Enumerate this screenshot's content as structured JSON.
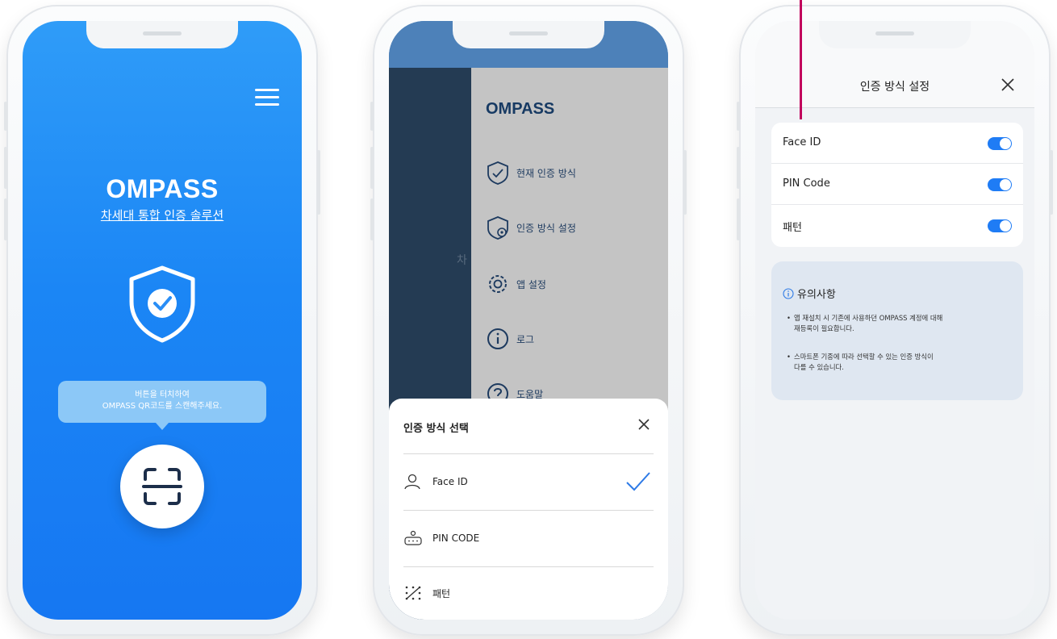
{
  "phone1": {
    "brand": "OMPASS",
    "subtitle": "차세대 통합 인증 솔루션",
    "tooltip_line1": "버튼을 터치하여",
    "tooltip_line2": "OMPASS QR코드를 스캔해주세요.",
    "accent_color": "#1b86f5",
    "menu_icon": "hamburger-icon",
    "scan_icon": "qr-scan-icon"
  },
  "phone2": {
    "ghost_char": "차",
    "drawer": {
      "title": "OMPASS",
      "items": [
        {
          "label": "현재 인증 방식",
          "icon": "shield-check-icon"
        },
        {
          "label": "인증 방식 설정",
          "icon": "shield-gear-icon"
        },
        {
          "label": "앱 설정",
          "icon": "gear-icon"
        },
        {
          "label": "로그",
          "icon": "info-icon"
        },
        {
          "label": "도움말",
          "icon": "help-icon"
        }
      ]
    },
    "sheet": {
      "title": "인증 방식 선택",
      "options": [
        {
          "label": "Face ID",
          "icon": "user-icon",
          "selected": true
        },
        {
          "label": "PIN CODE",
          "icon": "pin-keypad-icon",
          "selected": false
        },
        {
          "label": "패턴",
          "icon": "pattern-icon",
          "selected": false
        }
      ]
    }
  },
  "phone3": {
    "title": "인증 방식 설정",
    "toggles": [
      {
        "label": "Face ID",
        "on": true
      },
      {
        "label": "PIN Code",
        "on": true
      },
      {
        "label": "패턴",
        "on": true
      }
    ],
    "notice": {
      "title": "유의사항",
      "items": [
        {
          "line1": "앱 재설치 시 기존에 사용하던 OMPASS 계정에 대해",
          "line2": "재등록이 필요합니다."
        },
        {
          "line1": "스마트폰 기종에 따라 선택할 수 있는 인증 방식이",
          "line2": "다를 수 있습니다."
        }
      ]
    },
    "toggle_color": "#1f7cf5"
  }
}
